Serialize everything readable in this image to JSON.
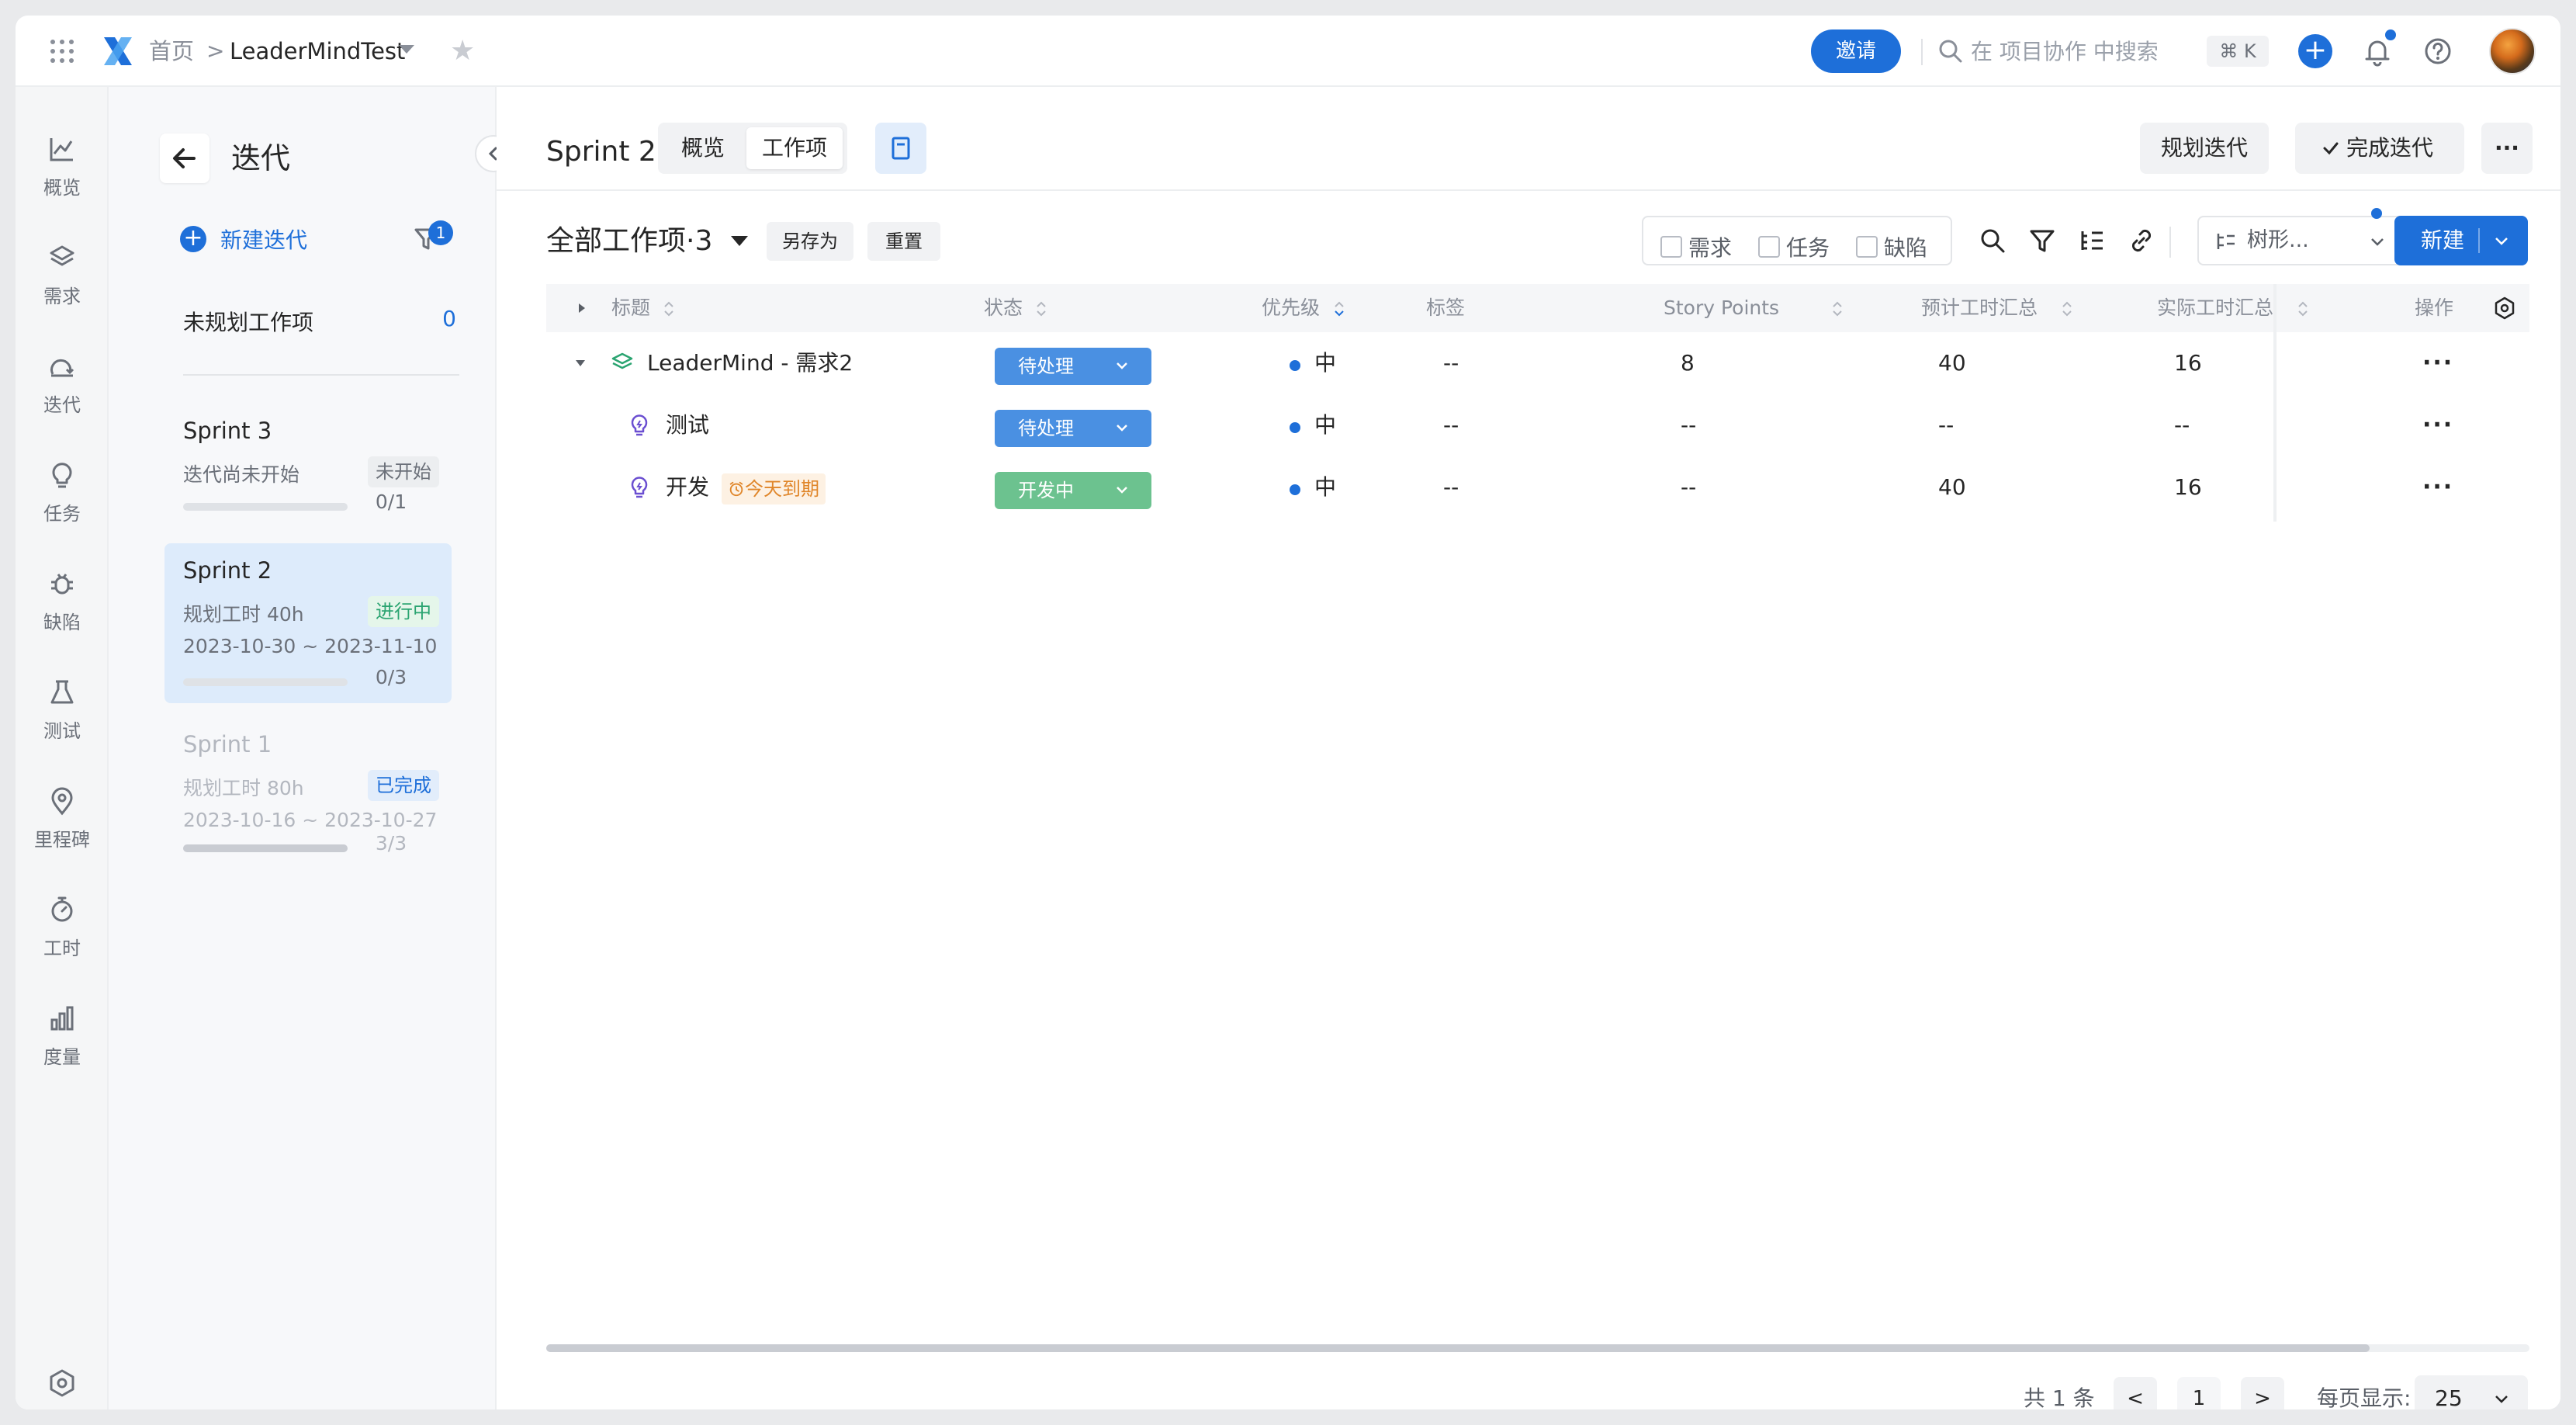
{
  "header": {
    "breadcrumb_home": "首页",
    "breadcrumb_sep": ">",
    "project_name": "LeaderMindTest",
    "invite_label": "邀请",
    "search_placeholder": "在 项目协作 中搜索",
    "shortcut": "⌘ K",
    "plus": "+"
  },
  "leftnav": {
    "items": [
      {
        "label": "概览",
        "icon": "overview-chart-icon"
      },
      {
        "label": "需求",
        "icon": "layers-icon"
      },
      {
        "label": "迭代",
        "icon": "iteration-icon"
      },
      {
        "label": "任务",
        "icon": "lightbulb-icon"
      },
      {
        "label": "缺陷",
        "icon": "bug-icon"
      },
      {
        "label": "测试",
        "icon": "flask-icon"
      },
      {
        "label": "里程碑",
        "icon": "location-pin-icon"
      },
      {
        "label": "工时",
        "icon": "stopwatch-icon"
      },
      {
        "label": "度量",
        "icon": "bar-chart-icon"
      }
    ]
  },
  "sprint_panel": {
    "title": "迭代",
    "new_iteration": "新建迭代",
    "filter_count": "1",
    "unplanned_label": "未规划工作项",
    "unplanned_count": "0",
    "sprints": [
      {
        "name": "Sprint 3",
        "line1": "迭代尚未开始",
        "badge": "未开始",
        "line2": "",
        "progress": "0/1",
        "progress_fraction": 0
      },
      {
        "name": "Sprint 2",
        "line1": "规划工时 40h",
        "badge": "进行中",
        "line2": "2023-10-30 ~ 2023-11-10",
        "progress": "0/3",
        "progress_fraction": 0
      },
      {
        "name": "Sprint 1",
        "line1": "规划工时 80h",
        "badge": "已完成",
        "line2": "2023-10-16 ~ 2023-10-27",
        "progress": "3/3",
        "progress_fraction": 1
      }
    ]
  },
  "main": {
    "title": "Sprint 2",
    "tabs": [
      "概览",
      "工作项"
    ],
    "plan_iteration": "规划迭代",
    "complete_iteration": "完成迭代",
    "more": "···",
    "filter_name": "全部工作项·3",
    "save_as": "另存为",
    "reset": "重置",
    "type_filters": [
      "需求",
      "任务",
      "缺陷"
    ],
    "view_mode": "树形...",
    "new_label": "新建"
  },
  "table": {
    "columns": [
      "标题",
      "状态",
      "优先级",
      "标签",
      "Story Points",
      "预计工时汇总",
      "实际工时汇总",
      "操作"
    ],
    "rows": [
      {
        "title": "LeaderMind - 需求2",
        "status": "待处理",
        "status_color": "#4a90e2",
        "priority": "中",
        "tags": "--",
        "story_points": "8",
        "est": "40",
        "actual": "16",
        "due": ""
      },
      {
        "title": "测试",
        "status": "待处理",
        "status_color": "#4a90e2",
        "priority": "中",
        "tags": "--",
        "story_points": "--",
        "est": "--",
        "actual": "--",
        "due": ""
      },
      {
        "title": "开发",
        "status": "开发中",
        "status_color": "#6cc28f",
        "priority": "中",
        "tags": "--",
        "story_points": "--",
        "est": "40",
        "actual": "16",
        "due": "今天到期"
      }
    ]
  },
  "pagination": {
    "total": "共 1 条",
    "page": "1",
    "per_page_label": "每页显示:",
    "per_page": "25",
    "prev": "<",
    "next": ">"
  },
  "colors": {
    "accent": "#1e6fd9",
    "status_pending": "#4a90e2",
    "status_dev": "#6cc28f",
    "in_progress_badge": "#2ba471",
    "done_badge": "#1e6fd9",
    "due_tag": "#e0862a"
  }
}
